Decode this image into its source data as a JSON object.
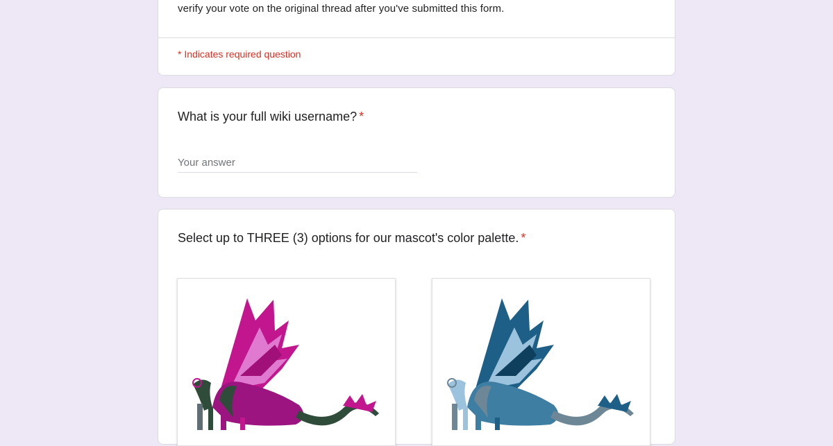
{
  "intro": {
    "text": "verify your vote on the original thread after you've submitted this form.",
    "required_note": "* Indicates required question"
  },
  "question1": {
    "title": "What is your full wiki username?",
    "required_marker": "*",
    "placeholder": "Your answer"
  },
  "question2": {
    "title": "Select up to THREE (3) options for our mascot's color palette.",
    "required_marker": "*",
    "options": [
      {
        "image": "dragon-icon",
        "palette": "magenta",
        "colors": [
          "#c2168f",
          "#e07ad0",
          "#2f4b3a"
        ]
      },
      {
        "image": "dragon-icon",
        "palette": "blue",
        "colors": [
          "#1d5f86",
          "#9cc3de",
          "#6e8797"
        ]
      }
    ]
  },
  "colors": {
    "background": "#ede7f6",
    "required": "#d93025"
  }
}
